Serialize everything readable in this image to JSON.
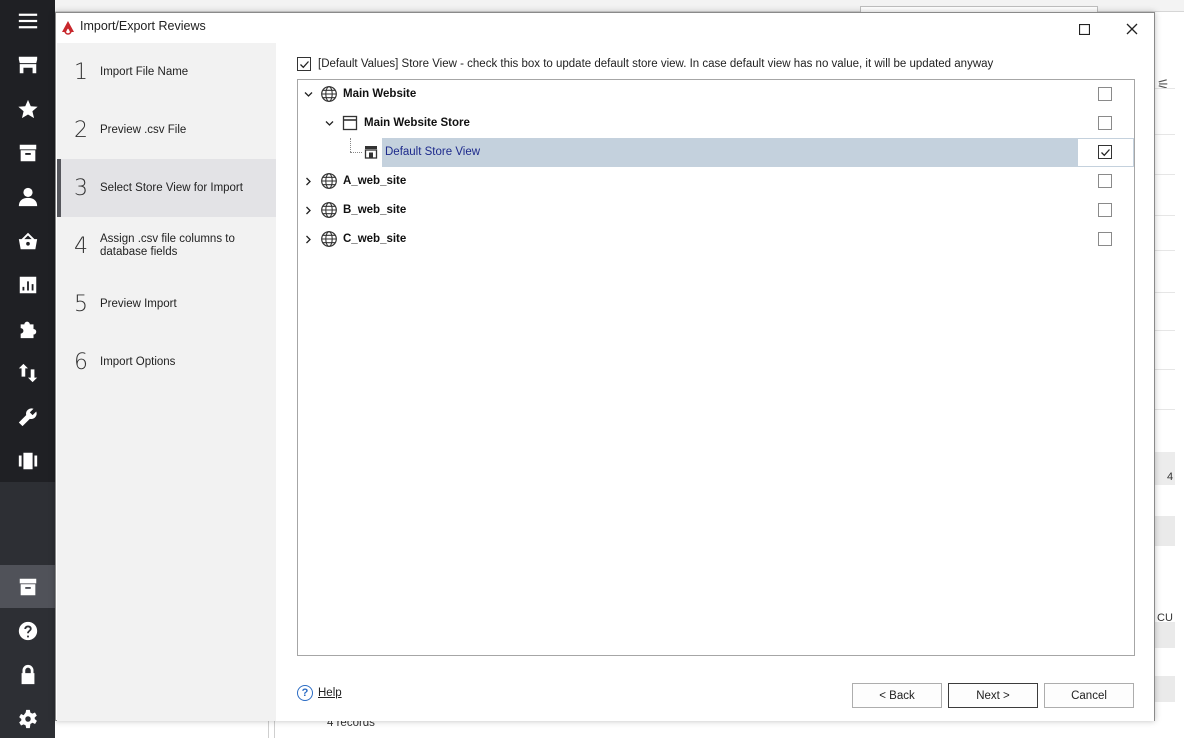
{
  "dialog": {
    "title": "Import/Export Reviews",
    "maximize_glyph": "☐",
    "close_glyph": "✕"
  },
  "steps": [
    {
      "num": "1",
      "label": "Import File Name"
    },
    {
      "num": "2",
      "label": "Preview .csv File"
    },
    {
      "num": "3",
      "label": "Select Store View for Import"
    },
    {
      "num": "4",
      "label": "Assign .csv file columns to database fields"
    },
    {
      "num": "5",
      "label": "Preview Import"
    },
    {
      "num": "6",
      "label": "Import Options"
    }
  ],
  "active_step": 3,
  "default_values": {
    "checked": true,
    "text": "[Default Values] Store View - check this box to update default store view. In case default view has no value, it will be updated anyway"
  },
  "tree": [
    {
      "label": "Main Website",
      "type": "website",
      "expanded": true,
      "checked": false
    },
    {
      "label": "Main Website Store",
      "type": "store",
      "expanded": true,
      "checked": false
    },
    {
      "label": "Default Store View",
      "type": "view",
      "selected": true,
      "checked": true
    },
    {
      "label": "A_web_site",
      "type": "website",
      "expanded": false,
      "checked": false
    },
    {
      "label": "B_web_site",
      "type": "website",
      "expanded": false,
      "checked": false
    },
    {
      "label": "C_web_site",
      "type": "website",
      "expanded": false,
      "checked": false
    }
  ],
  "footer": {
    "help": "Help",
    "back": "< Back",
    "next": "Next >",
    "cancel": "Cancel"
  },
  "background": {
    "records": "4 records",
    "right_cell_value": "4",
    "right_header": "CU"
  },
  "sidebar_icons": [
    "menu-icon",
    "store-icon",
    "star-icon",
    "archive-icon",
    "user-icon",
    "basket-icon",
    "report-icon",
    "puzzle-icon",
    "transfer-icon",
    "wrench-icon",
    "carousel-icon",
    "store-box-icon",
    "help-icon",
    "lock-icon",
    "gear-icon"
  ],
  "colors": {
    "sidebar": "#1f2024",
    "selection": "#c4d1dd",
    "selected_text": "#1d2a8c",
    "steps_bg": "#f2f2f2"
  }
}
